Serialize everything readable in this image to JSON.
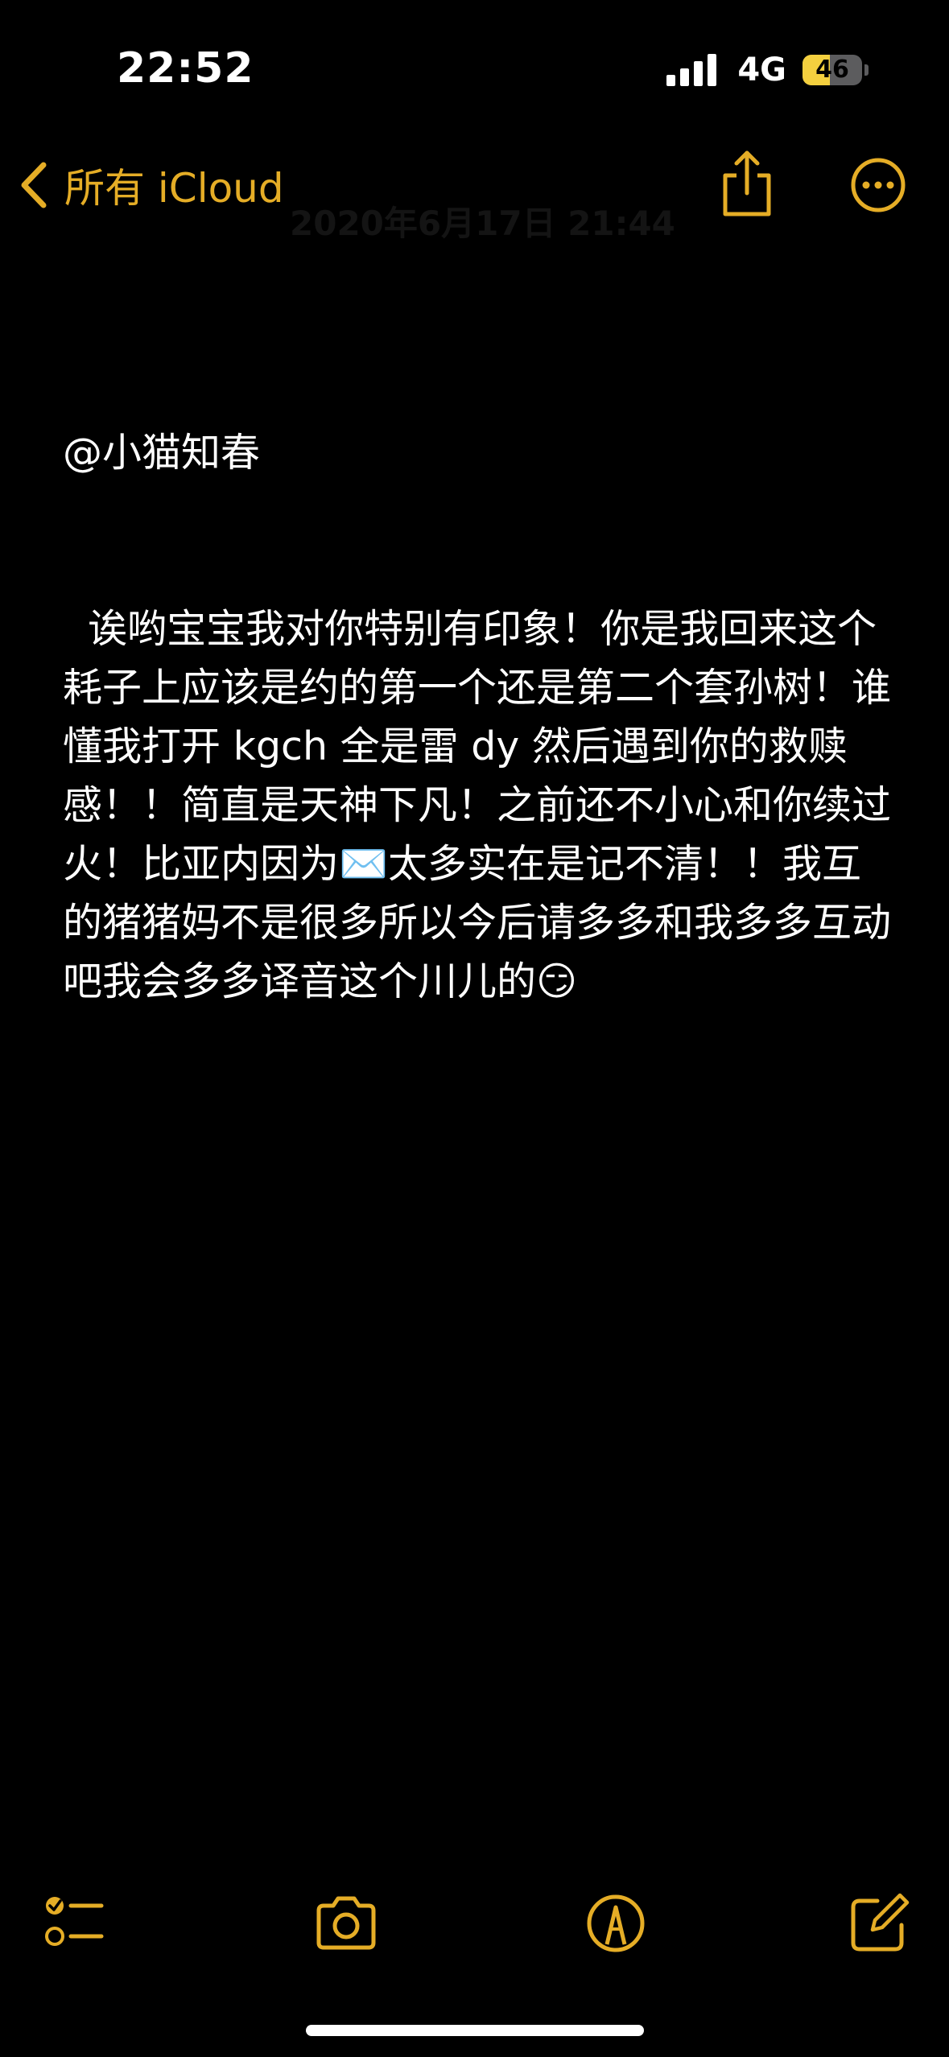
{
  "status_bar": {
    "time": "22:52",
    "network": "4G",
    "battery_percent": "46",
    "battery_level": 0.46
  },
  "nav": {
    "back_label": "所有 iCloud",
    "ghost_date": "2020年6月17日 21:44"
  },
  "note": {
    "mention": "@小猫知春",
    "body": "诶哟宝宝我对你特别有印象！你是我回来这个耗子上应该是约的第一个还是第二个套孙树！谁懂我打开 kgch 全是雷 dy 然后遇到你的救赎感！！简直是天神下凡！之前还不小心和你续过火！比亚内因为✉️太多实在是记不清！！我互的猪猪妈不是很多所以今后请多多和我多多互动吧我会多多译音这个川儿的😏"
  },
  "toolbar": {
    "items": [
      "checklist-icon",
      "camera-icon",
      "markup-icon",
      "compose-icon"
    ]
  },
  "colors": {
    "accent": "#e5ad26",
    "background": "#000000",
    "text": "#ffffff",
    "battery_fill": "#f4d03f"
  }
}
